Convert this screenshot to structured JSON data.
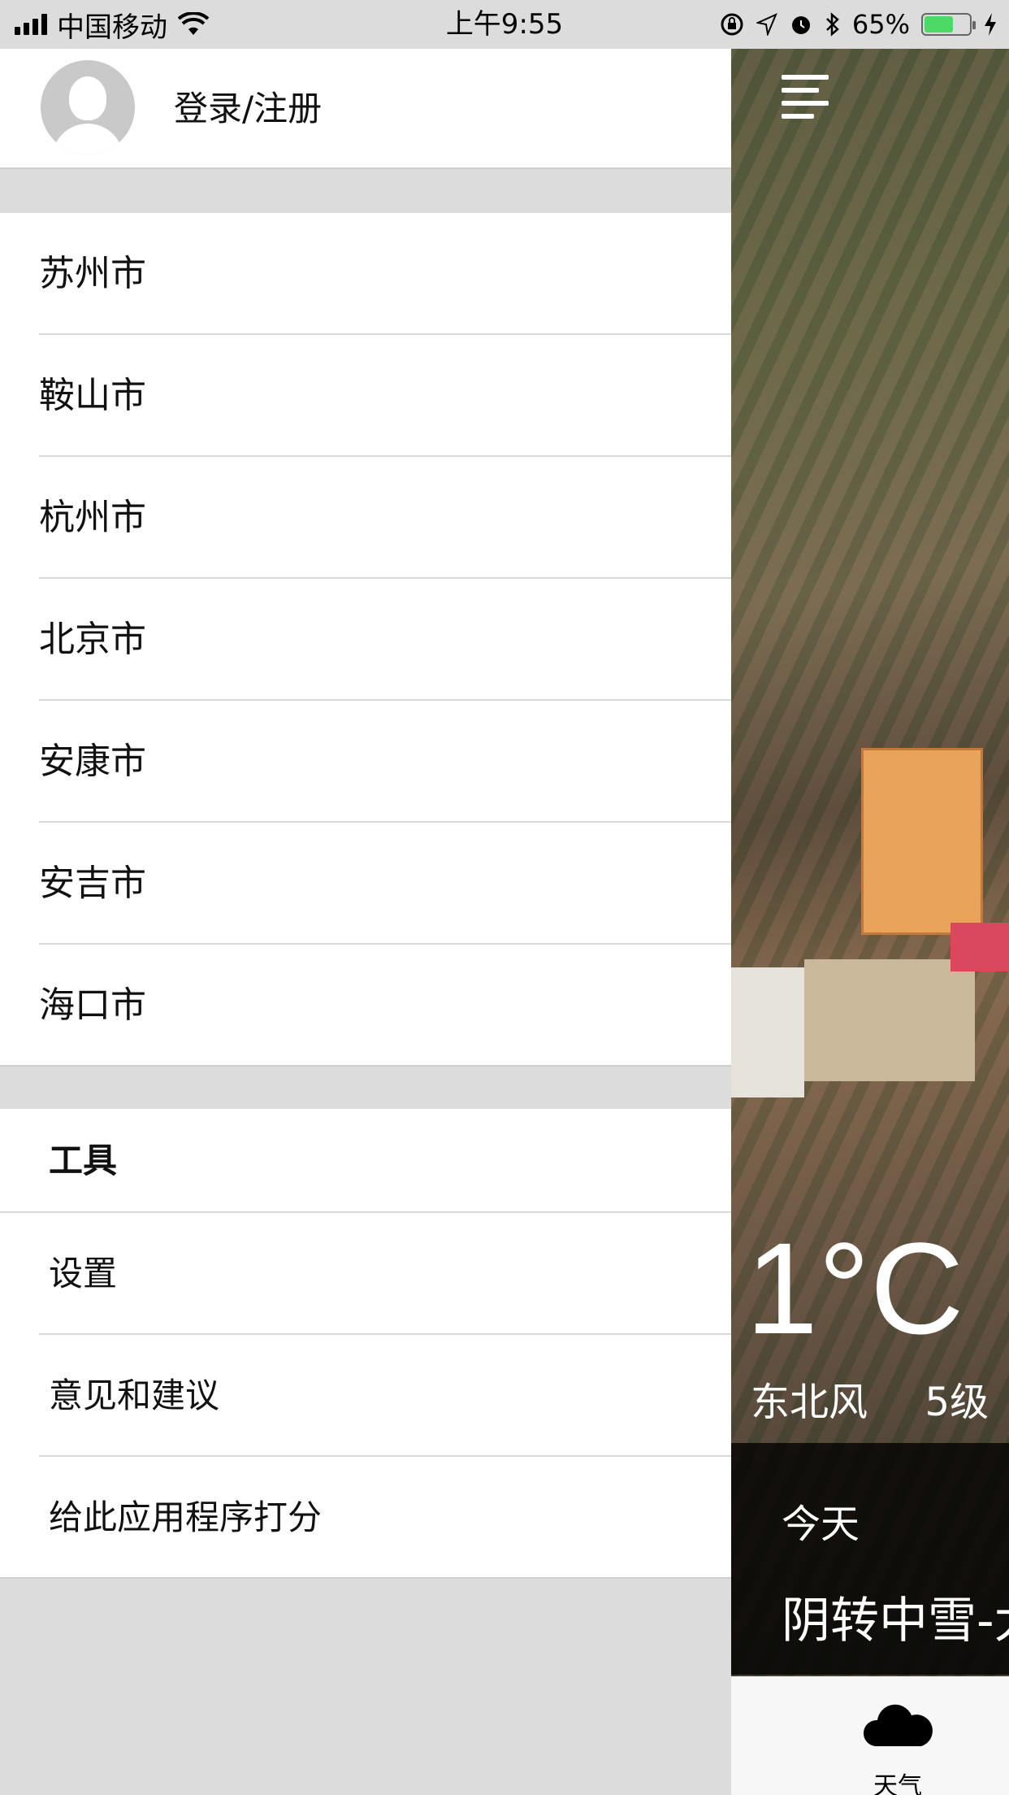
{
  "status_bar": {
    "carrier": "中国移动",
    "time": "上午9:55",
    "battery": "65%",
    "battery_level": 0.65,
    "icons": [
      "signal-icon",
      "wifi-icon",
      "orientation-lock-icon",
      "location-icon",
      "alarm-icon",
      "bluetooth-icon",
      "battery-icon",
      "charging-icon"
    ]
  },
  "drawer": {
    "login_label": "登录/注册",
    "cities": [
      "苏州市",
      "鞍山市",
      "杭州市",
      "北京市",
      "安康市",
      "安吉市",
      "海口市"
    ],
    "tools_header": "工具",
    "tools": [
      "设置",
      "意见和建议",
      "给此应用程序打分"
    ]
  },
  "weather": {
    "temperature": "1°C",
    "wind_direction": "东北风",
    "wind_level": "5级",
    "day": "今天",
    "description": "阴转中雪-大"
  },
  "tab_bar": {
    "weather_label": "天气"
  },
  "colors": {
    "battery_green": "#4cd964",
    "drawer_bg": "#dcdcdc",
    "forecast_bg": "#000000"
  }
}
